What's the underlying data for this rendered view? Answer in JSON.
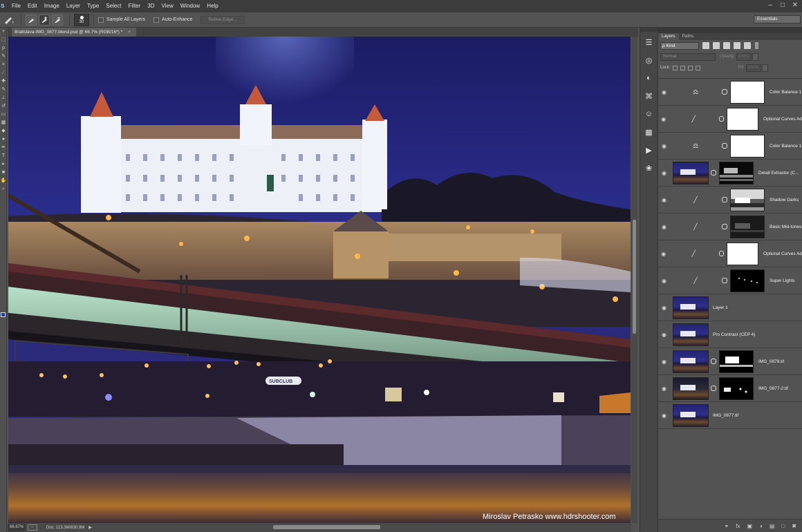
{
  "menu": {
    "logo": "s",
    "items": [
      "File",
      "Edit",
      "Image",
      "Layer",
      "Type",
      "Select",
      "Filter",
      "3D",
      "View",
      "Window",
      "Help"
    ],
    "window_controls": [
      "–",
      "□",
      "✕"
    ]
  },
  "options": {
    "brush_size": "30",
    "sample_all_layers": "Sample All Layers",
    "auto_enhance": "Auto-Enhance",
    "refine_edge": "Refine Edge...",
    "workspace": "Essentials"
  },
  "document": {
    "tab_title": "Bratislava-IMG_0877-blend.psd @ 66.7% (RGB/16*) *",
    "close": "×",
    "watermark": "Miroslav  Petrasko  www.hdrshooter.com",
    "sign": "SUBCLUB"
  },
  "status": {
    "zoom": "66.67%",
    "doc_size": "Doc: 113.3M/830.9M",
    "arrow": "▶"
  },
  "layers_panel": {
    "tabs": [
      "Layers",
      "Paths"
    ],
    "filter_kind": "ρ Kind",
    "blend_mode": "Normal",
    "opacity_label": "Opacity:",
    "opacity_value": "100%",
    "lock_label": "Lock:",
    "fill_label": "Fill:",
    "fill_value": "100%",
    "layers": [
      {
        "name": "Color Balance 1",
        "kind": "adjustment",
        "icon": "⚖",
        "mask": "white"
      },
      {
        "name": "Optional Curves Ad...",
        "kind": "adjustment",
        "icon": "╱",
        "mask": "white"
      },
      {
        "name": "Color Balance 1",
        "kind": "adjustment",
        "icon": "⚖",
        "mask": "white"
      },
      {
        "name": "Detail Extractor  (C...",
        "kind": "pixel-masked",
        "mask": "dark-detail"
      },
      {
        "name": "Shadow Darks",
        "kind": "adjustment",
        "icon": "╱",
        "mask": "gray-scene"
      },
      {
        "name": "Basic Mid-tones",
        "kind": "adjustment",
        "icon": "╱",
        "mask": "dark-scene"
      },
      {
        "name": "Optional Curves Ad...",
        "kind": "adjustment",
        "icon": "╱",
        "mask": "white"
      },
      {
        "name": "Super Lights",
        "kind": "adjustment",
        "icon": "╱",
        "mask": "black-dots"
      },
      {
        "name": "Layer 1",
        "kind": "pixel"
      },
      {
        "name": "Pro Contrast (CEP 4)",
        "kind": "pixel"
      },
      {
        "name": "IMG_0878.tif",
        "kind": "pixel-masked",
        "mask": "dark-castle"
      },
      {
        "name": "IMG_0877-2.tif",
        "kind": "pixel-masked",
        "mask": "dark-lights"
      },
      {
        "name": "IMG_0877.tif",
        "kind": "pixel"
      }
    ],
    "footer_icons": [
      "link-icon",
      "fx-icon",
      "mask-icon",
      "adjustment-icon",
      "group-icon",
      "new-layer-icon",
      "trash-icon"
    ],
    "footer_glyphs": [
      "⚭",
      "fx",
      "▣",
      "◑",
      "▤",
      "□",
      "✖"
    ]
  },
  "dock_icons": [
    "history-icon",
    "actions-icon",
    "adjustments-icon",
    "styles-icon",
    "tool-presets-icon",
    "grid-icon",
    "play-icon",
    "channels-icon"
  ],
  "dock_glyphs": [
    "☰",
    "◎",
    "◐",
    "⌘",
    "☺",
    "▦",
    "▶",
    "❀"
  ],
  "colors": {
    "sky": "#20216a",
    "accent": "#1a3fa0"
  }
}
